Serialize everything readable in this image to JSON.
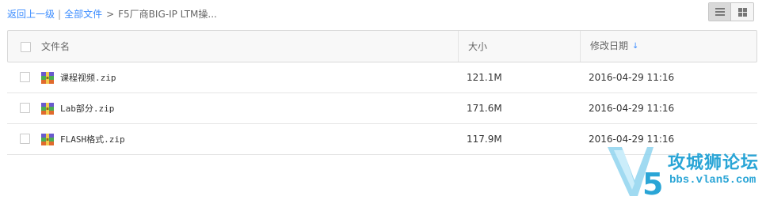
{
  "breadcrumb": {
    "back": "返回上一级",
    "separator": "|",
    "all_files": "全部文件",
    "arrow": ">",
    "current": "F5厂商BIG-IP LTM操..."
  },
  "view_switch": {
    "list_icon": "list-view-icon",
    "grid_icon": "grid-view-icon",
    "active": "list"
  },
  "table": {
    "columns": {
      "name": "文件名",
      "size": "大小",
      "date": "修改日期"
    },
    "sort_icon": "↓",
    "rows": [
      {
        "name": "课程视频.zip",
        "size": "121.1M",
        "date": "2016-04-29 11:16",
        "icon": "zip-file-icon"
      },
      {
        "name": "Lab部分.zip",
        "size": "171.6M",
        "date": "2016-04-29 11:16",
        "icon": "zip-file-icon"
      },
      {
        "name": "FLASH格式.zip",
        "size": "117.9M",
        "date": "2016-04-29 11:16",
        "icon": "zip-file-icon"
      }
    ]
  },
  "watermark": {
    "title": "攻城狮论坛",
    "url": "bbs.vlan5.com",
    "accent": "#2aa5d6"
  }
}
